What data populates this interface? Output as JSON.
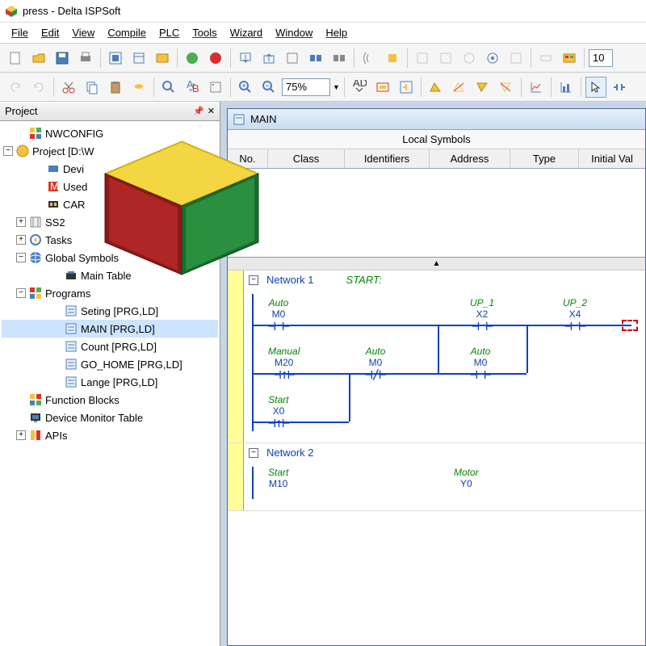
{
  "title": "press - Delta ISPSoft",
  "menu": [
    "File",
    "Edit",
    "View",
    "Compile",
    "PLC",
    "Tools",
    "Wizard",
    "Window",
    "Help"
  ],
  "toolbar2": {
    "zoom": "75%",
    "io": "10"
  },
  "project_panel": {
    "title": "Project"
  },
  "tree": {
    "nwconfig": "NWCONFIG",
    "project": "Project [D:\\W",
    "dev": "Devi",
    "used": "Used",
    "car": "CAR",
    "ss2": "SS2",
    "tasks": "Tasks",
    "gsym": "Global Symbols",
    "maintable": "Main Table",
    "programs": "Programs",
    "p1": "Seting [PRG,LD]",
    "p2": "MAIN [PRG,LD]",
    "p3": "Count [PRG,LD]",
    "p4": "GO_HOME [PRG,LD]",
    "p5": "Lange [PRG,LD]",
    "fb": "Function Blocks",
    "dmt": "Device Monitor Table",
    "apis": "APIs"
  },
  "doc": {
    "title": "MAIN",
    "symbols_title": "Local Symbols",
    "cols": {
      "no": "No.",
      "class": "Class",
      "ident": "Identifiers",
      "addr": "Address",
      "type": "Type",
      "init": "Initial Val"
    }
  },
  "net1": {
    "name": "Network 1",
    "label": "START:",
    "r1": {
      "c1": {
        "l1": "Auto",
        "l2": "M0"
      },
      "c2": {
        "l1": "UP_1",
        "l2": "X2"
      },
      "c3": {
        "l1": "UP_2",
        "l2": "X4"
      }
    },
    "r2": {
      "c1": {
        "l1": "Manual",
        "l2": "M20"
      },
      "c2": {
        "l1": "Auto",
        "l2": "M0"
      },
      "c3": {
        "l1": "Auto",
        "l2": "M0"
      }
    },
    "r3": {
      "c1": {
        "l1": "Start",
        "l2": "X0"
      }
    }
  },
  "net2": {
    "name": "Network 2",
    "r1": {
      "c1": {
        "l1": "Start",
        "l2": "M10"
      },
      "c2": {
        "l1": "Motor",
        "l2": "Y0"
      }
    }
  }
}
